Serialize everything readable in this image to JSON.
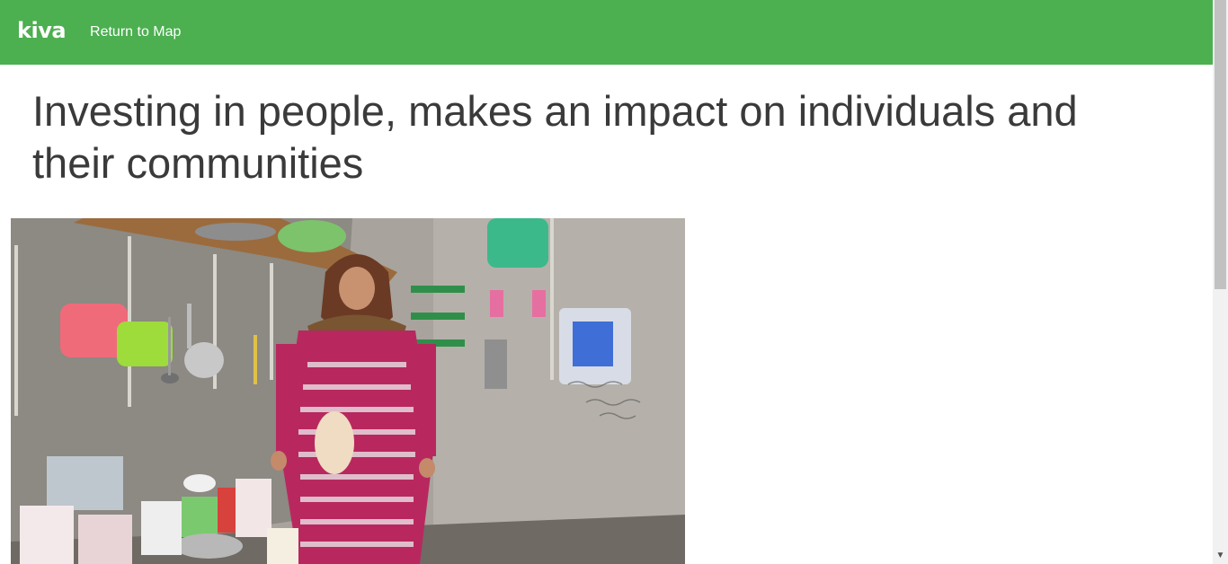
{
  "header": {
    "logo_text": "kiva",
    "return_link_label": "Return to Map",
    "bar_color": "#4caf50"
  },
  "main": {
    "headline": "Investing in people, makes an impact on individuals and their communities",
    "photo": {
      "description_icon": "borrower-photo"
    }
  },
  "scrollbar": {
    "down_arrow_icon": "chevron-down-icon"
  }
}
